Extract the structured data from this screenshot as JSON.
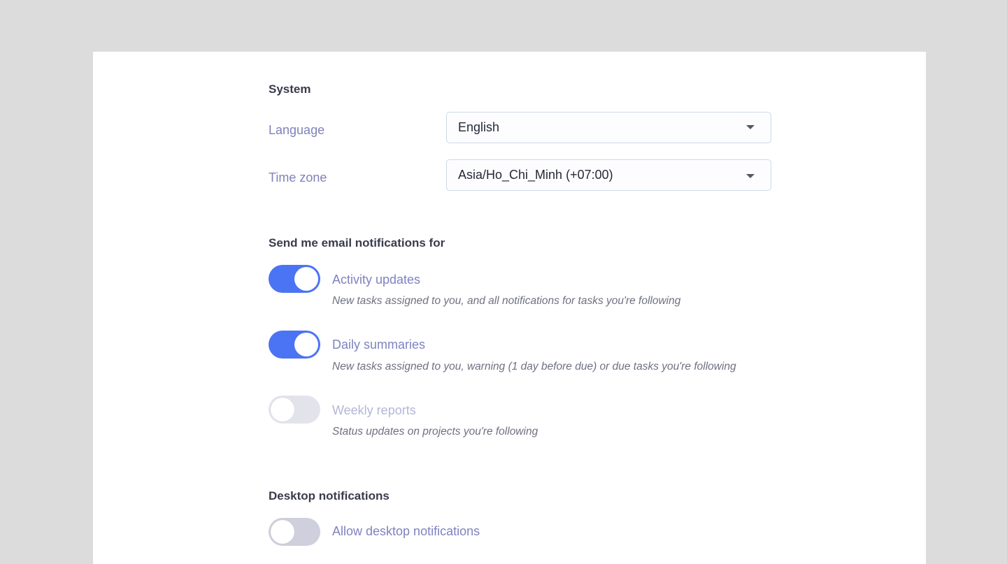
{
  "system": {
    "title": "System",
    "language_label": "Language",
    "language_value": "English",
    "timezone_label": "Time zone",
    "timezone_value": "Asia/Ho_Chi_Minh (+07:00)"
  },
  "email": {
    "title": "Send me email notifications for",
    "options": [
      {
        "label": "Activity updates",
        "description": "New tasks assigned to you, and all notifications for tasks you're following",
        "enabled": true
      },
      {
        "label": "Daily summaries",
        "description": "New tasks assigned to you, warning (1 day before due) or due tasks you're following",
        "enabled": true
      },
      {
        "label": "Weekly reports",
        "description": "Status updates on projects you're following",
        "enabled": false
      }
    ]
  },
  "desktop": {
    "title": "Desktop notifications",
    "allow_label": "Allow desktop notifications",
    "allow_enabled": false
  },
  "colors": {
    "toggle_on": "#4b74f4",
    "toggle_off": "#e3e3ec",
    "label_accent": "#7f82c0",
    "page_background": "#dcdcdc"
  }
}
